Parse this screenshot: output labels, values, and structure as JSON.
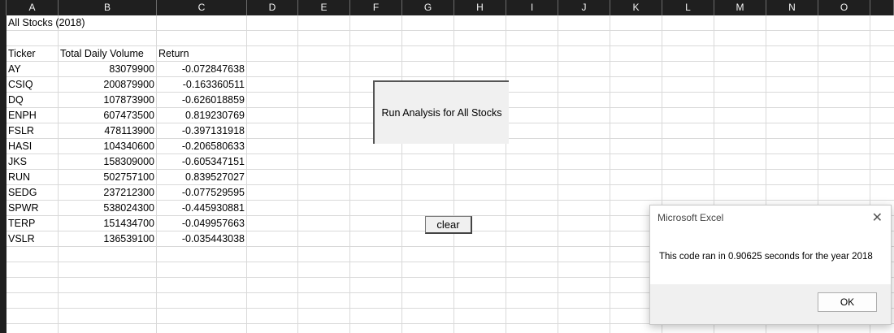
{
  "columns": [
    "A",
    "B",
    "C",
    "D",
    "E",
    "F",
    "G",
    "H",
    "I",
    "J",
    "K",
    "L",
    "M",
    "N",
    "O"
  ],
  "sheet": {
    "title": "All Stocks (2018)",
    "headers": [
      "Ticker",
      "Total Daily Volume",
      "Return"
    ],
    "rows": [
      [
        "AY",
        "83079900",
        "-0.072847638"
      ],
      [
        "CSIQ",
        "200879900",
        "-0.163360511"
      ],
      [
        "DQ",
        "107873900",
        "-0.626018859"
      ],
      [
        "ENPH",
        "607473500",
        "0.819230769"
      ],
      [
        "FSLR",
        "478113900",
        "-0.397131918"
      ],
      [
        "HASI",
        "104340600",
        "-0.206580633"
      ],
      [
        "JKS",
        "158309000",
        "-0.605347151"
      ],
      [
        "RUN",
        "502757100",
        "0.839527027"
      ],
      [
        "SEDG",
        "237212300",
        "-0.077529595"
      ],
      [
        "SPWR",
        "538024300",
        "-0.445930881"
      ],
      [
        "TERP",
        "151434700",
        "-0.049957663"
      ],
      [
        "VSLR",
        "136539100",
        "-0.035443038"
      ]
    ]
  },
  "buttons": {
    "run_analysis": "Run Analysis for All Stocks",
    "clear": "clear"
  },
  "dialog": {
    "title": "Microsoft Excel",
    "message": "This code ran in 0.90625 seconds for the year 2018",
    "ok": "OK",
    "close_glyph": "✕"
  }
}
